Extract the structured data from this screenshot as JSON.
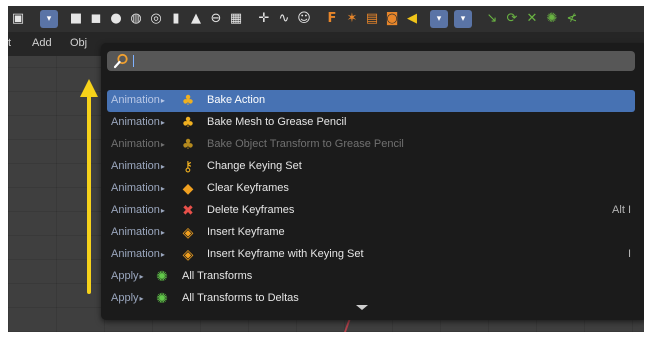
{
  "header_menu": [
    "t",
    "Add",
    "Obj"
  ],
  "search": {
    "value": "",
    "placeholder": ""
  },
  "results": [
    {
      "category": "Animation",
      "label": "Bake Action",
      "shortcut": "",
      "selected": true,
      "disabled": false,
      "icon": "bake-icon"
    },
    {
      "category": "Animation",
      "label": "Bake Mesh to Grease Pencil",
      "shortcut": "",
      "selected": false,
      "disabled": false,
      "icon": "bake-icon"
    },
    {
      "category": "Animation",
      "label": "Bake Object Transform to Grease Pencil",
      "shortcut": "",
      "selected": false,
      "disabled": true,
      "icon": "bake-icon"
    },
    {
      "category": "Animation",
      "label": "Change Keying Set",
      "shortcut": "",
      "selected": false,
      "disabled": false,
      "icon": "keying-set-icon"
    },
    {
      "category": "Animation",
      "label": "Clear Keyframes",
      "shortcut": "",
      "selected": false,
      "disabled": false,
      "icon": "keyframes-icon"
    },
    {
      "category": "Animation",
      "label": "Delete Keyframes",
      "shortcut": "Alt I",
      "selected": false,
      "disabled": false,
      "icon": "delete-keyframe-icon"
    },
    {
      "category": "Animation",
      "label": "Insert Keyframe",
      "shortcut": "",
      "selected": false,
      "disabled": false,
      "icon": "insert-keyframe-icon"
    },
    {
      "category": "Animation",
      "label": "Insert Keyframe with Keying Set",
      "shortcut": "I",
      "selected": false,
      "disabled": false,
      "icon": "insert-keyframe-icon"
    },
    {
      "category": "Apply",
      "label": "All Transforms",
      "shortcut": "",
      "selected": false,
      "disabled": false,
      "icon": "transform-icon"
    },
    {
      "category": "Apply",
      "label": "All Transforms to Deltas",
      "shortcut": "",
      "selected": false,
      "disabled": false,
      "icon": "transform-icon"
    }
  ],
  "colors": {
    "selection": "#4772b3",
    "arrow": "#f6d21a",
    "popup_bg": "#1b1b1b"
  }
}
